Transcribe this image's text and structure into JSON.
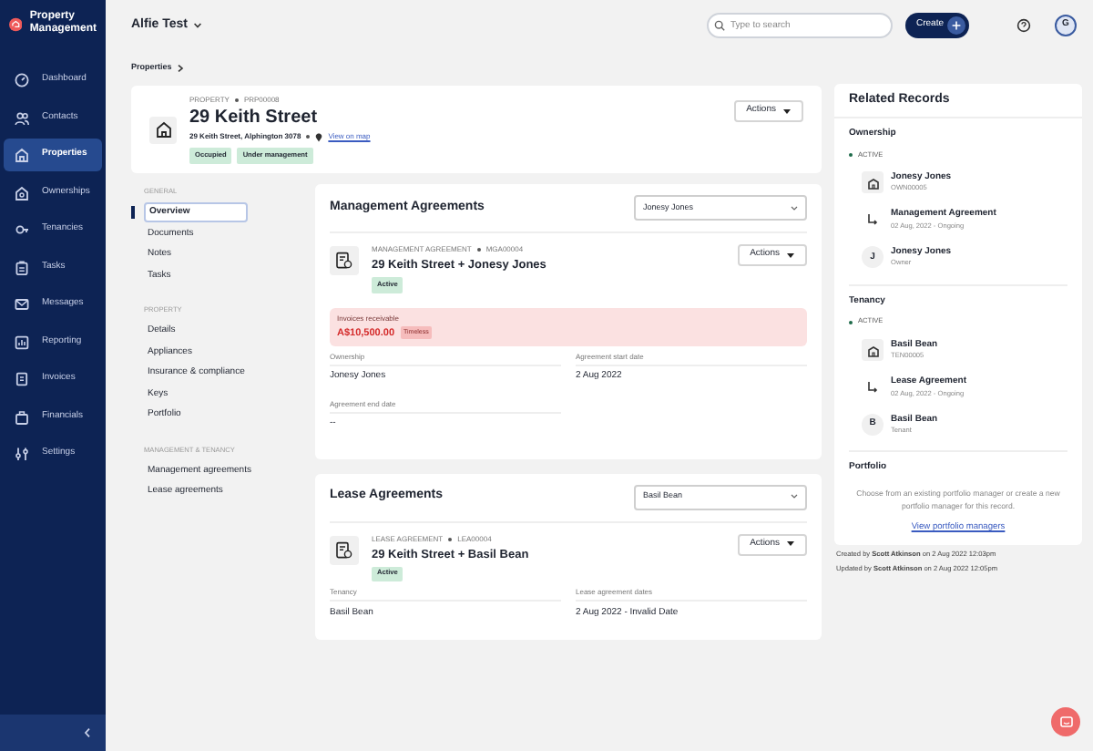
{
  "sidebar": {
    "brand": [
      "Property",
      "Management"
    ],
    "items": [
      {
        "label": "Dashboard",
        "selected": false
      },
      {
        "label": "Contacts",
        "selected": false
      },
      {
        "label": "Properties",
        "selected": true
      },
      {
        "label": "Ownerships",
        "selected": false
      },
      {
        "label": "Tenancies",
        "selected": false
      },
      {
        "label": "Tasks",
        "selected": false
      },
      {
        "label": "Messages",
        "selected": false
      },
      {
        "label": "Reporting",
        "selected": false
      },
      {
        "label": "Invoices",
        "selected": false
      },
      {
        "label": "Financials",
        "selected": false
      },
      {
        "label": "Settings",
        "selected": false
      }
    ]
  },
  "header": {
    "workspace": "Alfie Test",
    "search": {
      "placeholder": "Type to search"
    },
    "create_button": "Create",
    "avatar": "G"
  },
  "breadcrumb": "Properties",
  "property": {
    "kind_label": "PROPERTY",
    "ref": "PRP00008",
    "title": "29 Keith Street",
    "address": "29 Keith Street, Alphington 3078",
    "map_link": "View on map",
    "tags": [
      "Occupied",
      "Under management"
    ],
    "actions": "Actions"
  },
  "subnav": [
    {
      "heading": "GENERAL",
      "items": [
        {
          "label": "Overview",
          "selected": true
        },
        {
          "label": "Documents",
          "selected": false
        },
        {
          "label": "Notes",
          "selected": false
        },
        {
          "label": "Tasks",
          "selected": false
        }
      ]
    },
    {
      "heading": "PROPERTY",
      "items": [
        {
          "label": "Details",
          "selected": false
        },
        {
          "label": "Appliances",
          "selected": false
        },
        {
          "label": "Insurance & compliance",
          "selected": false
        },
        {
          "label": "Keys",
          "selected": false
        },
        {
          "label": "Portfolio",
          "selected": false
        }
      ]
    },
    {
      "heading": "MANAGEMENT & TENANCY",
      "items": [
        {
          "label": "Management agreements",
          "selected": false
        },
        {
          "label": "Lease agreements",
          "selected": false
        }
      ]
    }
  ],
  "agreements": [
    {
      "title": "Management Agreements",
      "selector": "Jonesy Jones",
      "kind_label": "MANAGEMENT AGREEMENT",
      "ref": "MGA00004",
      "name": "29 Keith Street + Jonesy Jones",
      "status": "Active",
      "actions": "Actions",
      "alert": {
        "label": "Invoices receivable",
        "amount": "A$10,500.00",
        "badge": "Timeless"
      },
      "fields": [
        {
          "label": "Ownership",
          "value": "Jonesy Jones"
        },
        {
          "label": "Agreement start date",
          "value": "2 Aug 2022"
        },
        {
          "label": "Agreement end date",
          "value": "--"
        }
      ]
    },
    {
      "title": "Lease Agreements",
      "selector": "Basil Bean",
      "kind_label": "LEASE AGREEMENT",
      "ref": "LEA00004",
      "name": "29 Keith Street + Basil Bean",
      "status": "Active",
      "actions": "Actions",
      "fields": [
        {
          "label": "Tenancy",
          "value": "Basil Bean"
        },
        {
          "label": "Lease agreement dates",
          "value": "2 Aug 2022 - Invalid Date"
        }
      ]
    }
  ],
  "related": {
    "title": "Related Records",
    "groups": [
      {
        "heading": "Ownership",
        "status": "ACTIVE",
        "items": [
          {
            "kind": "entity",
            "title": "Jonesy Jones",
            "sub": "OWN00005"
          },
          {
            "kind": "link",
            "title": "Management Agreement",
            "sub": "02 Aug, 2022 - Ongoing"
          },
          {
            "kind": "person",
            "initial": "J",
            "title": "Jonesy Jones",
            "sub": "Owner"
          }
        ]
      },
      {
        "heading": "Tenancy",
        "status": "ACTIVE",
        "items": [
          {
            "kind": "entity",
            "title": "Basil Bean",
            "sub": "TEN00005"
          },
          {
            "kind": "link",
            "title": "Lease Agreement",
            "sub": "02 Aug, 2022 - Ongoing"
          },
          {
            "kind": "person",
            "initial": "B",
            "title": "Basil Bean",
            "sub": "Tenant"
          }
        ]
      }
    ],
    "portfolio": {
      "heading": "Portfolio",
      "text": "Choose from an existing portfolio manager or create a new portfolio manager for this record.",
      "link": "View portfolio managers"
    }
  },
  "audit": [
    "Created by **Scott Atkinson** on 2 Aug 2022 12:03pm",
    "Updated by **Scott Atkinson** on 2 Aug 2022 12:05pm"
  ]
}
